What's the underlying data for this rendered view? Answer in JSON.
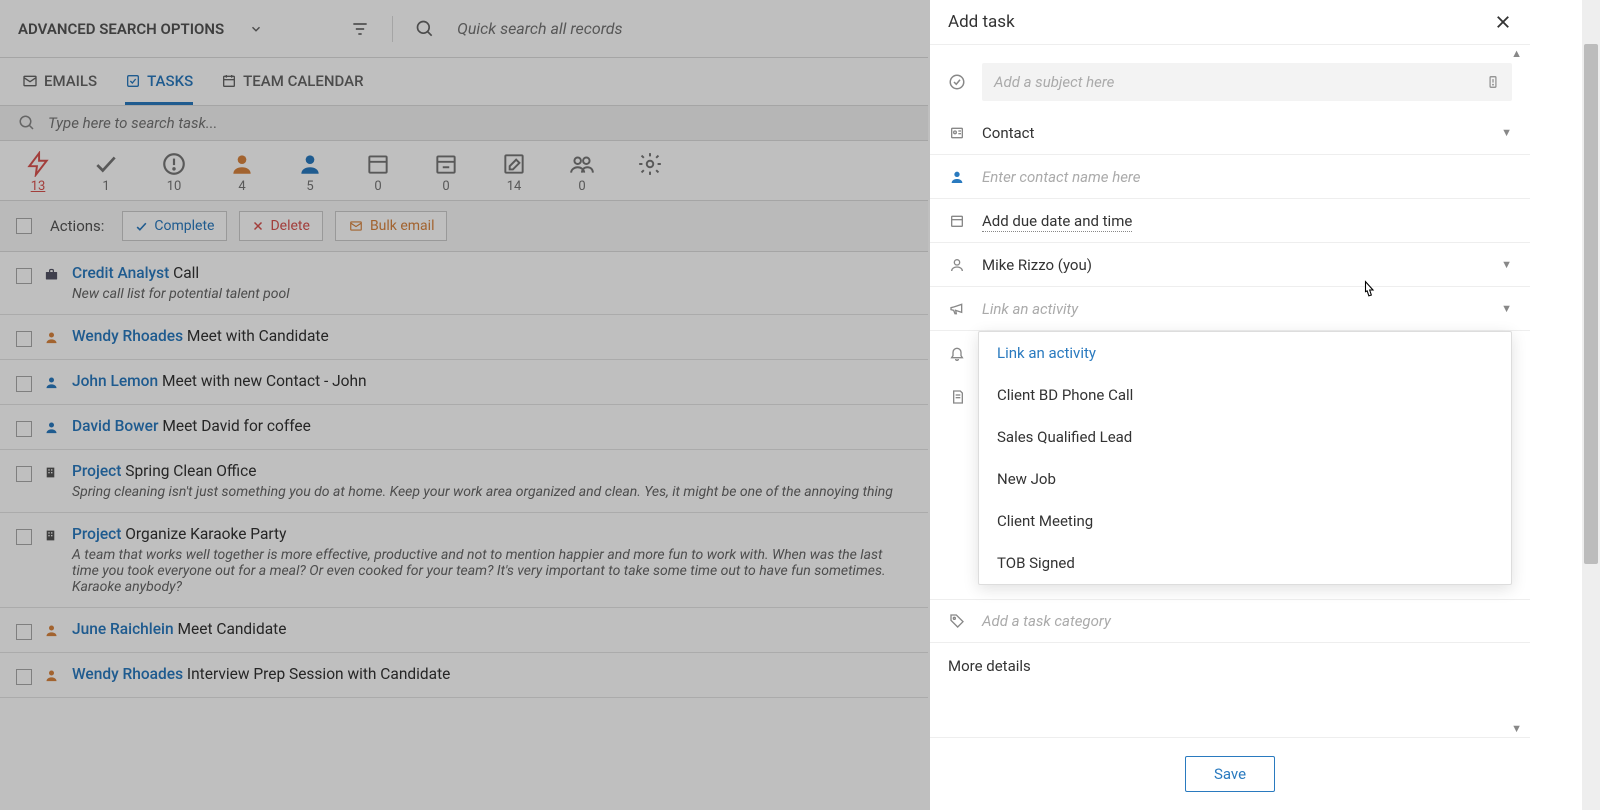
{
  "header": {
    "adv_search": "ADVANCED SEARCH OPTIONS",
    "quick_search_placeholder": "Quick search all records"
  },
  "tabs": {
    "emails": "EMAILS",
    "tasks": "TASKS",
    "team_calendar": "TEAM CALENDAR",
    "active": "tasks"
  },
  "task_search_placeholder": "Type here to search task...",
  "filters": [
    {
      "name": "bolt",
      "count": "13",
      "active": true
    },
    {
      "name": "check",
      "count": "1"
    },
    {
      "name": "alert",
      "count": "10"
    },
    {
      "name": "person-orange",
      "count": "4"
    },
    {
      "name": "person-blue",
      "count": "5"
    },
    {
      "name": "calendar",
      "count": "0"
    },
    {
      "name": "calendar-minus",
      "count": "0"
    },
    {
      "name": "edit",
      "count": "14"
    },
    {
      "name": "group",
      "count": "0"
    },
    {
      "name": "gear",
      "count": ""
    }
  ],
  "actions": {
    "label": "Actions:",
    "complete": "Complete",
    "delete": "Delete",
    "bulk_email": "Bulk email"
  },
  "tasks_list": [
    {
      "icon": "briefcase",
      "link": "Credit Analyst",
      "text": " Call",
      "desc": "New call list for potential talent pool"
    },
    {
      "icon": "person-orange",
      "link": "Wendy Rhoades",
      "text": " Meet with Candidate"
    },
    {
      "icon": "person-blue",
      "link": "John Lemon",
      "text": " Meet with new Contact - John"
    },
    {
      "icon": "person-blue",
      "link": "David Bower",
      "text": " Meet David for coffee"
    },
    {
      "icon": "building",
      "link": "Project",
      "text": " Spring Clean Office",
      "desc": "Spring cleaning isn't just something you do at home. Keep your work area organized and clean. Yes, it might be one of the annoying thing"
    },
    {
      "icon": "building",
      "link": "Project",
      "text": " Organize Karaoke Party",
      "desc": "A team that works well together is more effective, productive and not to mention happier and more fun to work with. When was the last time you took everyone out for a meal? Or even cooked for your team? It's very important to take some time out to have fun sometimes. Karaoke anybody?"
    },
    {
      "icon": "person-orange",
      "link": "June Raichlein",
      "text": " Meet Candidate"
    },
    {
      "icon": "person-orange",
      "link": "Wendy Rhoades",
      "text": " Interview Prep Session with Candidate"
    }
  ],
  "panel": {
    "title": "Add task",
    "subject_placeholder": "Add a subject here",
    "contact_label": "Contact",
    "contact_placeholder": "Enter contact name here",
    "due_date": "Add due date and time",
    "assignee": "Mike Rizzo (you)",
    "activity_placeholder": "Link an activity",
    "activity_options": [
      "Link an activity",
      "Client BD Phone Call",
      "Sales Qualified Lead",
      "New Job",
      "Client Meeting",
      "TOB Signed"
    ],
    "category_placeholder": "Add a task category",
    "more_details": "More details",
    "save": "Save"
  }
}
